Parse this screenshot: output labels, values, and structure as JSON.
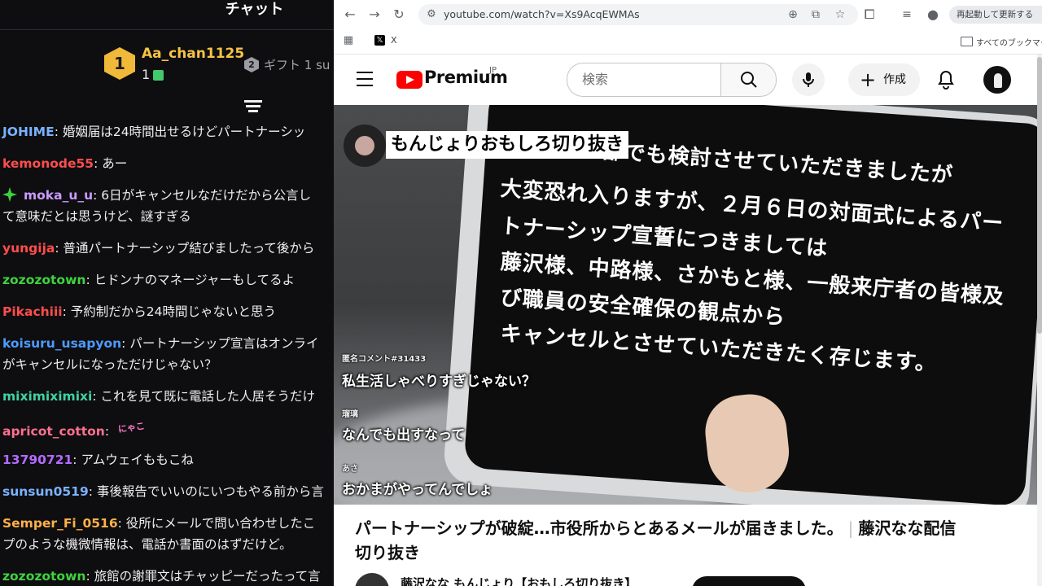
{
  "chat": {
    "title": "チャット",
    "leaderboard": {
      "rank": "1",
      "user": "Aa_chan1125",
      "count": "1",
      "rank2": "2",
      "gift_text": "ギフト 1 su"
    },
    "messages": [
      {
        "user": "JOHIME",
        "text": "婚姻届は24時間出せるけどパートナーシッ",
        "color": "#7ab2ff"
      },
      {
        "user": "kemonode55",
        "text": "あー",
        "color": "#ff4d4d"
      },
      {
        "user": "moka_u_u",
        "text": "6日がキャンセルなだけだから公言し",
        "text2": "て意味だとは思うけど、謎すぎる",
        "color": "#c99bff"
      },
      {
        "user": "yungija",
        "text": "普通パートナーシップ結びましたって後から",
        "color": "#ff4d4d"
      },
      {
        "user": "zozozotown",
        "text": "ヒドンナのマネージャーもしてるよ",
        "color": "#3fd33f"
      },
      {
        "user": "Pikachiii",
        "text": "予約制だから24時間じゃないと思う",
        "color": "#ff4d4d"
      },
      {
        "user": "koisuru_usapyon",
        "text": "パートナーシップ宣言はオンライ",
        "text2": "がキャンセルになっただけじゃない？",
        "color": "#4d9bff"
      },
      {
        "user": "miximiximixi",
        "text": "これを見て既に電話した人居そうだけ",
        "color": "#3fd3a0"
      },
      {
        "user": "apricot_cotton",
        "text": "",
        "emote": "にゃこ",
        "color": "#ff6f91"
      },
      {
        "user": "13790721",
        "text": "アムウェイももこね",
        "color": "#b36bff"
      },
      {
        "user": "sunsun0519",
        "text": "事後報告でいいのにいつもやる前から言",
        "color": "#7ab2ff"
      },
      {
        "user": "Semper_Fi_0516",
        "text": "役所にメールで問い合わせしたこ",
        "text2": "プのような機微情報は、電話か書面のはずだけど。",
        "color": "#ffb04d"
      },
      {
        "user": "zozozotown",
        "text": "旅館の謝罪文はチャッピーだったって言",
        "color": "#3fd33f"
      }
    ]
  },
  "browser": {
    "url": "youtube.com/watch?v=Xs9AcqEWMAs",
    "restart_label": "再起動して更新する",
    "bookmark_x": "X",
    "all_bookmarks": "すべてのブックマーク"
  },
  "youtube": {
    "logo_text": "Premium",
    "region": "JP",
    "search_placeholder": "検索",
    "create_label": "作成"
  },
  "video": {
    "channel_tag": "もんじょりおもしろ切り抜き",
    "phone_lines": [
      "部でも検討させていただきましたが",
      "大変恐れ入りますが、２月６日の対面式によるパー",
      "トナーシップ宣誓につきましては",
      "藤沢様、中路様、さかもと様、一般来庁者の皆様及",
      "び職員の安全確保の観点から",
      "キャンセルとさせていただきたく存じます。"
    ],
    "comments": [
      {
        "name": "匿名コメント#31433",
        "text": "私生活しゃべりすぎじゃない？"
      },
      {
        "name": "瑠璃",
        "text": "なんでも出すなって"
      },
      {
        "name": "あさ",
        "text": "おかまがやってんでしょ"
      }
    ]
  },
  "title": {
    "main": "パートナーシップが破綻…市役所からとあるメールが届きました。",
    "sep": "|",
    "suffix": "藤沢なな配信",
    "line2": "切り抜き",
    "owner": "藤沢なな もんじょり【おもしろ切り抜き】"
  }
}
